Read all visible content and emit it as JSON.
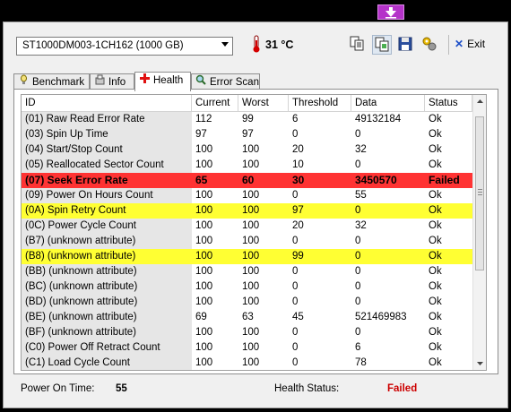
{
  "toolbar": {
    "drive": "ST1000DM003-1CH162 (1000 GB)",
    "temperature": "31 °C",
    "exit_label": "Exit"
  },
  "tabs": [
    {
      "label": "Benchmark",
      "icon": "benchmark-icon",
      "active": false
    },
    {
      "label": "Info",
      "icon": "info-icon",
      "active": false
    },
    {
      "label": "Health",
      "icon": "health-cross-icon",
      "active": true
    },
    {
      "label": "Error Scan",
      "icon": "magnifier-icon",
      "active": false
    }
  ],
  "table": {
    "columns": [
      "ID",
      "Current",
      "Worst",
      "Threshold",
      "Data",
      "Status"
    ],
    "rows": [
      {
        "id": "(01) Raw Read Error Rate",
        "current": "112",
        "worst": "99",
        "threshold": "6",
        "data": "49132184",
        "status": "Ok",
        "state": "normal"
      },
      {
        "id": "(03) Spin Up Time",
        "current": "97",
        "worst": "97",
        "threshold": "0",
        "data": "0",
        "status": "Ok",
        "state": "normal"
      },
      {
        "id": "(04) Start/Stop Count",
        "current": "100",
        "worst": "100",
        "threshold": "20",
        "data": "32",
        "status": "Ok",
        "state": "normal"
      },
      {
        "id": "(05) Reallocated Sector Count",
        "current": "100",
        "worst": "100",
        "threshold": "10",
        "data": "0",
        "status": "Ok",
        "state": "normal"
      },
      {
        "id": "(07) Seek Error Rate",
        "current": "65",
        "worst": "60",
        "threshold": "30",
        "data": "3450570",
        "status": "Failed",
        "state": "failed"
      },
      {
        "id": "(09) Power On Hours Count",
        "current": "100",
        "worst": "100",
        "threshold": "0",
        "data": "55",
        "status": "Ok",
        "state": "normal"
      },
      {
        "id": "(0A) Spin Retry Count",
        "current": "100",
        "worst": "100",
        "threshold": "97",
        "data": "0",
        "status": "Ok",
        "state": "warning"
      },
      {
        "id": "(0C) Power Cycle Count",
        "current": "100",
        "worst": "100",
        "threshold": "20",
        "data": "32",
        "status": "Ok",
        "state": "normal"
      },
      {
        "id": "(B7) (unknown attribute)",
        "current": "100",
        "worst": "100",
        "threshold": "0",
        "data": "0",
        "status": "Ok",
        "state": "normal"
      },
      {
        "id": "(B8) (unknown attribute)",
        "current": "100",
        "worst": "100",
        "threshold": "99",
        "data": "0",
        "status": "Ok",
        "state": "warning"
      },
      {
        "id": "(BB) (unknown attribute)",
        "current": "100",
        "worst": "100",
        "threshold": "0",
        "data": "0",
        "status": "Ok",
        "state": "normal"
      },
      {
        "id": "(BC) (unknown attribute)",
        "current": "100",
        "worst": "100",
        "threshold": "0",
        "data": "0",
        "status": "Ok",
        "state": "normal"
      },
      {
        "id": "(BD) (unknown attribute)",
        "current": "100",
        "worst": "100",
        "threshold": "0",
        "data": "0",
        "status": "Ok",
        "state": "normal"
      },
      {
        "id": "(BE) (unknown attribute)",
        "current": "69",
        "worst": "63",
        "threshold": "45",
        "data": "521469983",
        "status": "Ok",
        "state": "normal"
      },
      {
        "id": "(BF) (unknown attribute)",
        "current": "100",
        "worst": "100",
        "threshold": "0",
        "data": "0",
        "status": "Ok",
        "state": "normal"
      },
      {
        "id": "(C0) Power Off Retract Count",
        "current": "100",
        "worst": "100",
        "threshold": "0",
        "data": "6",
        "status": "Ok",
        "state": "normal"
      },
      {
        "id": "(C1) Load Cycle Count",
        "current": "100",
        "worst": "100",
        "threshold": "0",
        "data": "78",
        "status": "Ok",
        "state": "normal"
      }
    ]
  },
  "status_bar": {
    "power_on_label": "Power On Time:",
    "power_on_value": "55",
    "health_label": "Health Status:",
    "health_value": "Failed"
  },
  "colors": {
    "failed_row": "#ff3333",
    "warning_row": "#ffff33",
    "health_failed_text": "#cc0000",
    "temperature_icon": "#d40000"
  }
}
